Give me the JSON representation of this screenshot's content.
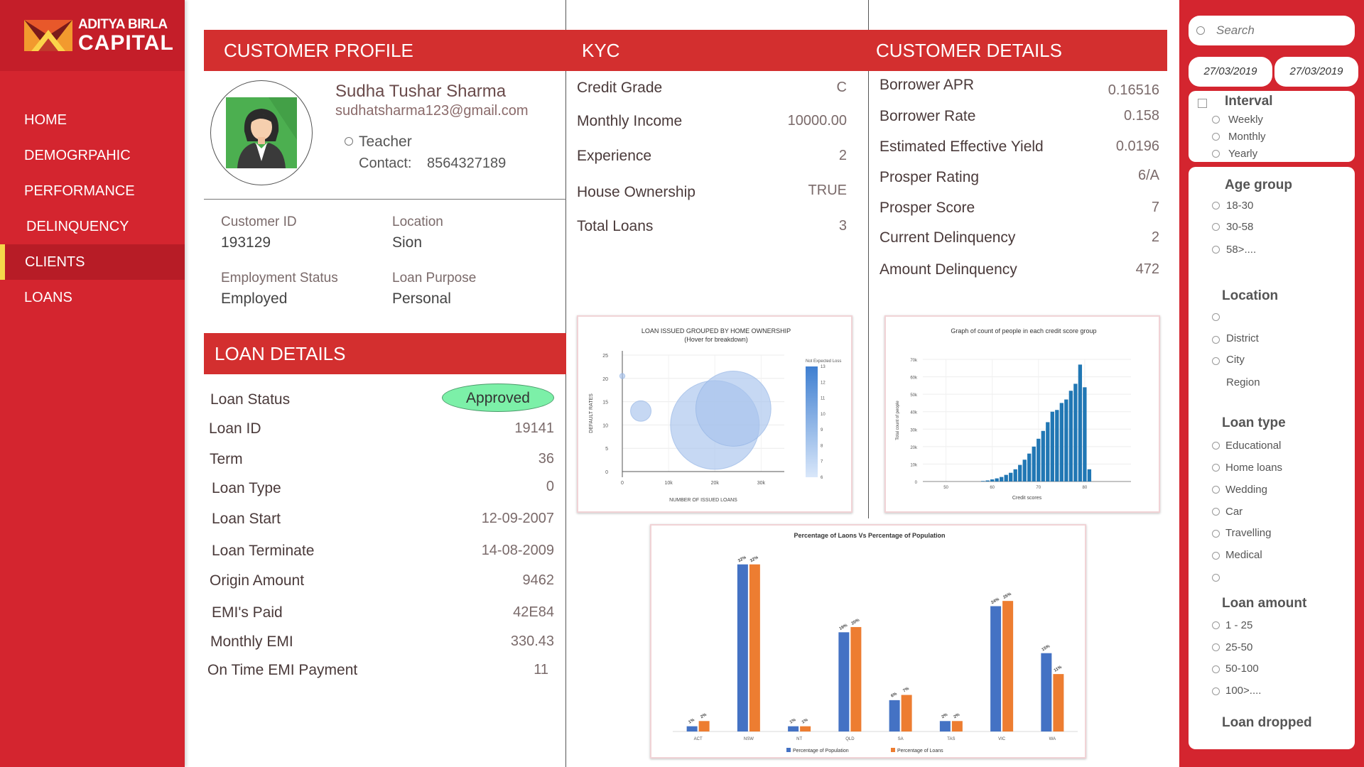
{
  "brand": {
    "line1": "ADITYA BIRLA",
    "line2": "CAPITAL"
  },
  "nav": {
    "items": [
      {
        "label": "HOME"
      },
      {
        "label": "DEMOGRPAHIC"
      },
      {
        "label": "PERFORMANCE"
      },
      {
        "label": "DELINQUENCY"
      },
      {
        "label": "CLIENTS"
      },
      {
        "label": "LOANS"
      }
    ],
    "active": "CLIENTS"
  },
  "profile": {
    "header": "CUSTOMER PROFILE",
    "name": "Sudha Tushar Sharma",
    "email": "sudhatsharma123@gmail.com",
    "occupation": "Teacher",
    "contact_label": "Contact:",
    "contact_value": "8564327189",
    "customer_id_label": "Customer ID",
    "customer_id": "193129",
    "location_label": "Location",
    "location": "Sion",
    "employment_label": "Employment Status",
    "employment": "Employed",
    "purpose_label": "Loan Purpose",
    "purpose": "Personal"
  },
  "kyc": {
    "header": "KYC",
    "rows": [
      {
        "label": "Credit Grade",
        "value": "C"
      },
      {
        "label": "Monthly Income",
        "value": "10000.00"
      },
      {
        "label": "Experience",
        "value": "2"
      },
      {
        "label": "House Ownership",
        "value": "TRUE"
      },
      {
        "label": "Total Loans",
        "value": "3"
      }
    ]
  },
  "customer_details": {
    "header": "CUSTOMER DETAILS",
    "rows": [
      {
        "label": "Borrower APR",
        "value": "0.16516"
      },
      {
        "label": "Borrower Rate",
        "value": "0.158"
      },
      {
        "label": "Estimated Effective Yield",
        "value": "0.0196"
      },
      {
        "label": "Prosper Rating",
        "value": "6/A"
      },
      {
        "label": "Prosper Score",
        "value": "7"
      },
      {
        "label": "Current Delinquency",
        "value": "2"
      },
      {
        "label": "Amount Delinquency",
        "value": "472"
      }
    ]
  },
  "loan_details": {
    "header": "LOAN DETAILS",
    "status_label": "Loan Status",
    "status_value": "Approved",
    "rows": [
      {
        "label": "Loan ID",
        "value": "19141"
      },
      {
        "label": "Term",
        "value": "36"
      },
      {
        "label": "Loan Type",
        "value": "0"
      },
      {
        "label": "Loan Start",
        "value": "12-09-2007"
      },
      {
        "label": "Loan Terminate",
        "value": "14-08-2009"
      },
      {
        "label": "Origin Amount",
        "value": "9462"
      },
      {
        "label": "EMI's Paid",
        "value": "42E84"
      },
      {
        "label": "Monthly EMI",
        "value": "330.43"
      },
      {
        "label": "On Time EMI Payment",
        "value": "11"
      }
    ]
  },
  "filters": {
    "search_placeholder": "Search",
    "date_from": "27/03/2019",
    "date_to": "27/03/2019",
    "interval": {
      "title": "Interval",
      "options": [
        "Weekly",
        "Monthly",
        "Yearly"
      ]
    },
    "age_group": {
      "title": "Age group",
      "options": [
        "18-30",
        "30-58",
        "58>...."
      ]
    },
    "location": {
      "title": "Location",
      "options": [
        "",
        "District",
        "City",
        "Region"
      ]
    },
    "loan_type": {
      "title": "Loan type",
      "options": [
        "Educational",
        "Home loans",
        "Wedding",
        "Car",
        "Travelling",
        "Medical",
        ""
      ]
    },
    "loan_amount": {
      "title": "Loan amount",
      "options": [
        "1 - 25",
        "25-50",
        "50-100",
        "100>...."
      ]
    },
    "loan_dropped": {
      "title": "Loan dropped"
    }
  },
  "chart_data": [
    {
      "type": "scatter",
      "title": "LOAN ISSUED GROUPED BY HOME OWNERSHIP",
      "subtitle": "(Hover for breakdown)",
      "xlabel": "NUMBER OF ISSUED LOANS",
      "ylabel": "DEFAULT RATES",
      "xlim": [
        0,
        35000
      ],
      "ylim": [
        0,
        25
      ],
      "x_ticks": [
        "0",
        "10k",
        "20k",
        "30k"
      ],
      "y_ticks": [
        "0",
        "5",
        "10",
        "15",
        "20",
        "25"
      ],
      "colorbar_label": "Not Expected Loss",
      "colorbar_ticks": [
        "6",
        "7",
        "8",
        "9",
        "10",
        "11",
        "12",
        "13"
      ],
      "points": [
        {
          "x": 0,
          "y": 20.5,
          "size": 1
        },
        {
          "x": 4000,
          "y": 13,
          "size": 10
        },
        {
          "x": 20000,
          "y": 10,
          "size": 50
        },
        {
          "x": 24000,
          "y": 13.5,
          "size": 42
        }
      ],
      "colors": {
        "point": "#a7c3ec",
        "edge": "#8fb0e2",
        "colorbar_top": "#3f7fd1",
        "colorbar_bottom": "#d9e7fa"
      }
    },
    {
      "type": "bar",
      "title": "Graph of count of people in each credit score group",
      "xlabel": "Credit scores",
      "ylabel": "Total count of people",
      "xlim": [
        45,
        90
      ],
      "ylim": [
        0,
        70000
      ],
      "x_ticks": [
        "50",
        "60",
        "70",
        "80"
      ],
      "y_ticks": [
        "0",
        "10k",
        "20k",
        "30k",
        "40k",
        "50k",
        "60k",
        "70k"
      ],
      "x": [
        58,
        59,
        60,
        61,
        62,
        63,
        64,
        65,
        66,
        67,
        68,
        69,
        70,
        71,
        72,
        73,
        74,
        75,
        76,
        77,
        78,
        79,
        80,
        81
      ],
      "values": [
        300,
        600,
        1200,
        1800,
        2600,
        3800,
        5000,
        7000,
        9500,
        12500,
        16000,
        20000,
        24500,
        29000,
        34000,
        40000,
        41000,
        45000,
        47000,
        52000,
        56000,
        67000,
        54000,
        7000
      ],
      "color": "#2177b4"
    },
    {
      "type": "bar",
      "title": "Percentage of Laons Vs Percentage of Population",
      "categories": [
        "ACT",
        "NSW",
        "NT",
        "QLD",
        "SA",
        "TAS",
        "VIC",
        "WA"
      ],
      "series": [
        {
          "name": "Percentage of Population",
          "values": [
            1,
            32,
            1,
            19,
            6,
            2,
            24,
            15
          ],
          "labels": [
            "1%",
            "32%",
            "1%",
            "19%",
            "6%",
            "2%",
            "24%",
            "15%"
          ],
          "color": "#4472c4"
        },
        {
          "name": "Percentage of Loans",
          "values": [
            2,
            32,
            1,
            20,
            7,
            2,
            25,
            11
          ],
          "labels": [
            "2%",
            "32%",
            "1%",
            "20%",
            "7%",
            "2%",
            "25%",
            "11%"
          ],
          "color": "#ed7d31"
        }
      ],
      "ylim": [
        0,
        34
      ],
      "legend": "bottom"
    }
  ]
}
